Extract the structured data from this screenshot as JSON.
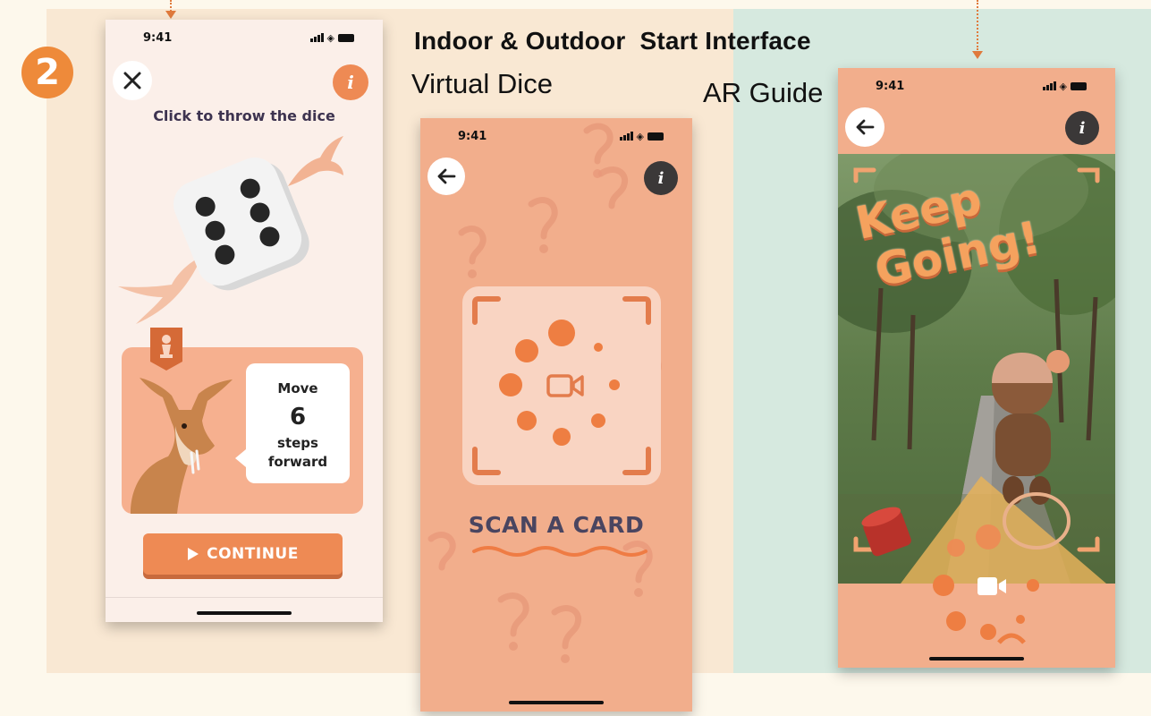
{
  "headings": {
    "main": "Indoor & Outdoor  Start Interface",
    "virtual_dice": "Virtual Dice",
    "ar_guide": "AR Guide"
  },
  "step_number": "2",
  "colors": {
    "accent_orange": "#ee8a3a",
    "left_panel": "#f9e8d3",
    "right_panel": "#d6e9df",
    "phone_orange": "#f2ae8c",
    "dark_text": "#3d3350"
  },
  "phone_dice": {
    "time": "9:41",
    "close_icon": "close-icon",
    "info_icon": "info-icon",
    "title": "Click to throw the dice",
    "dice_pips": 6,
    "move_label": "Move",
    "move_number": "6",
    "move_steps": "steps",
    "move_direction": "forward",
    "continue_label": "CONTINUE"
  },
  "phone_scan": {
    "time": "9:41",
    "back_icon": "back-arrow-icon",
    "info_icon": "info-icon",
    "camera_icon": "video-camera-icon",
    "scan_label": "SCAN A CARD"
  },
  "phone_ar": {
    "time": "9:41",
    "back_icon": "back-arrow-icon",
    "info_icon": "info-icon",
    "overlay_line1": "Keep",
    "overlay_line2": "Going!",
    "camera_icon": "video-camera-icon"
  }
}
